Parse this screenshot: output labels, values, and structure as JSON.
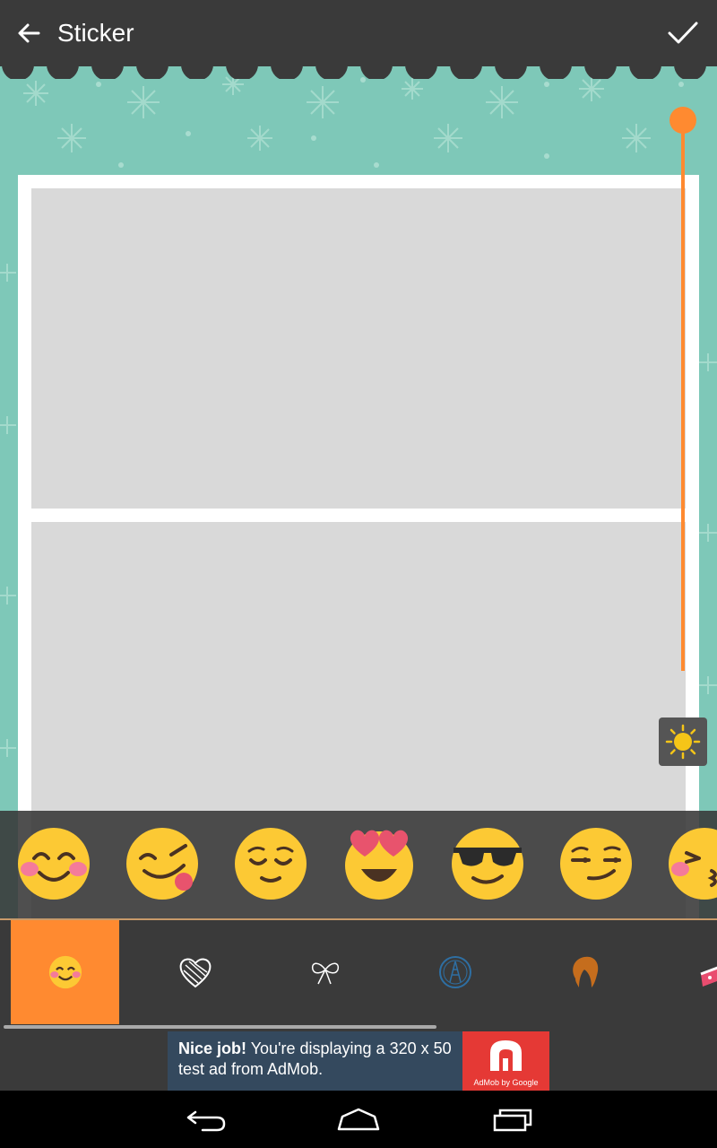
{
  "app": {
    "title": "Sticker"
  },
  "colors": {
    "accent": "#ff8a30",
    "toolbar": "#3a3a3a",
    "canvas_background": "#7ec8b8",
    "photo_placeholder": "#d9d9d9",
    "ad_background": "#34495e",
    "ad_logo": "#e53935"
  },
  "icons": {
    "back": "arrow-left-icon",
    "confirm": "check-icon",
    "brightness": "sun-icon"
  },
  "slider": {
    "value_fraction": 1.0
  },
  "stickers": [
    {
      "name": "smiling-blush-emoji"
    },
    {
      "name": "yum-tongue-emoji"
    },
    {
      "name": "relieved-emoji"
    },
    {
      "name": "heart-eyes-emoji"
    },
    {
      "name": "sunglasses-emoji"
    },
    {
      "name": "smirk-emoji"
    },
    {
      "name": "kissing-blush-emoji"
    }
  ],
  "categories": [
    {
      "name": "emoji-category",
      "active": true
    },
    {
      "name": "hearts-category",
      "active": false
    },
    {
      "name": "bows-category",
      "active": false
    },
    {
      "name": "paris-stamp-category",
      "active": false
    },
    {
      "name": "hair-category",
      "active": false
    },
    {
      "name": "cake-category",
      "active": false
    }
  ],
  "ad": {
    "bold": "Nice job!",
    "text": " You're displaying a 320 x 50 test ad from AdMob.",
    "logo_caption": "AdMob by Google"
  },
  "navbar": {
    "back": "nav-back-icon",
    "home": "nav-home-icon",
    "recents": "nav-recents-icon"
  }
}
